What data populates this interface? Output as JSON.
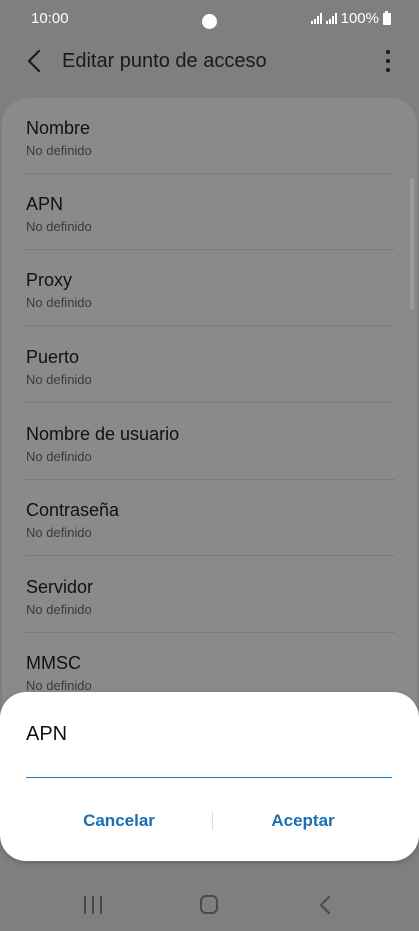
{
  "status_bar": {
    "time": "10:00",
    "battery": "100%"
  },
  "header": {
    "title": "Editar punto de acceso"
  },
  "settings": [
    {
      "label": "Nombre",
      "value": "No definido"
    },
    {
      "label": "APN",
      "value": "No definido"
    },
    {
      "label": "Proxy",
      "value": "No definido"
    },
    {
      "label": "Puerto",
      "value": "No definido"
    },
    {
      "label": "Nombre de usuario",
      "value": "No definido"
    },
    {
      "label": "Contraseña",
      "value": "No definido"
    },
    {
      "label": "Servidor",
      "value": "No definido"
    },
    {
      "label": "MMSC",
      "value": "No definido"
    }
  ],
  "dialog": {
    "title": "APN",
    "input_value": "",
    "cancel_label": "Cancelar",
    "accept_label": "Aceptar"
  },
  "colors": {
    "accent": "#1a6eb5",
    "input_underline": "#1a7bc8"
  }
}
